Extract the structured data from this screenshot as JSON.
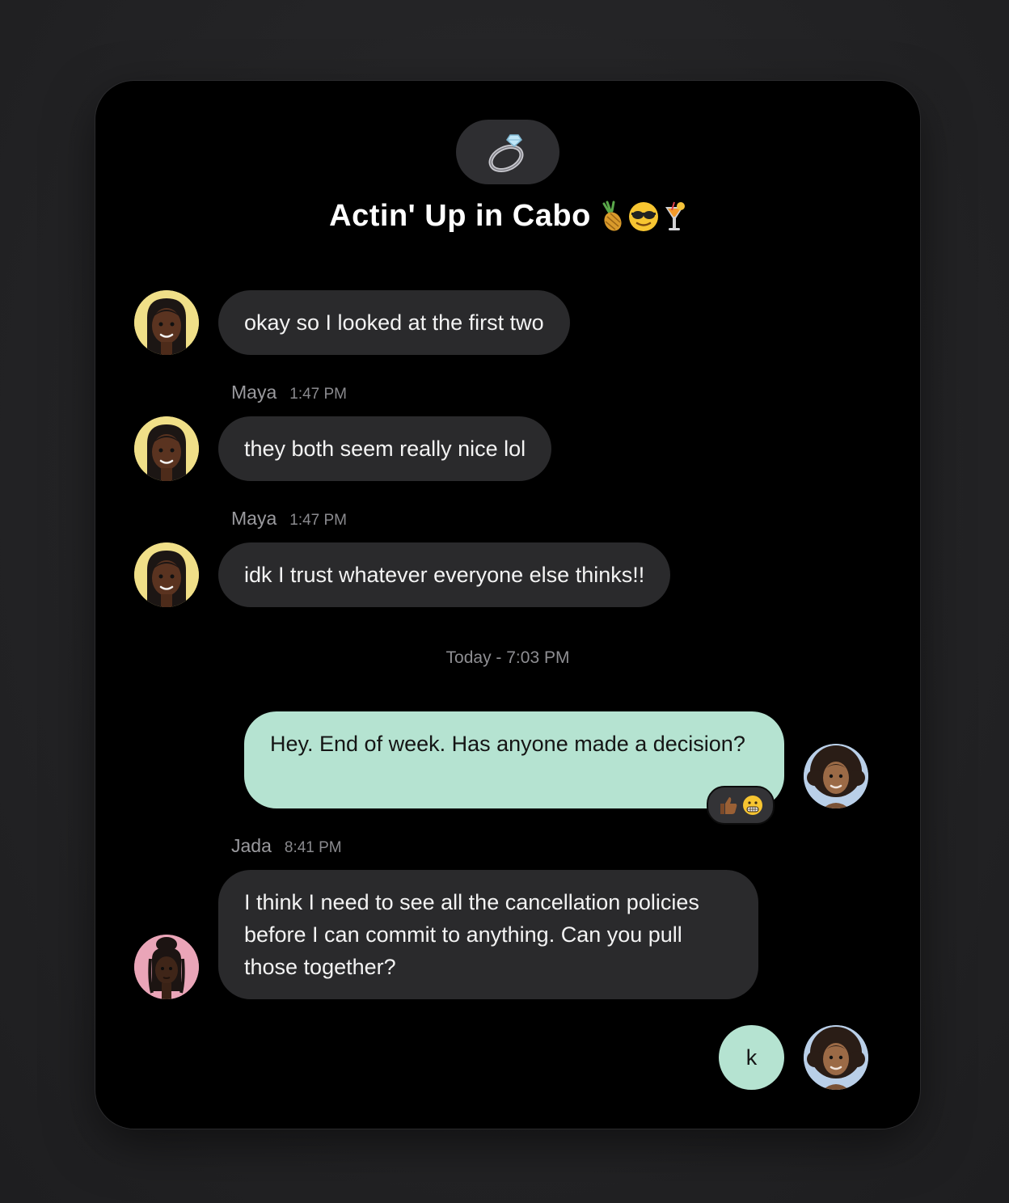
{
  "chat": {
    "group_icon": "ring-icon",
    "title": "Actin' Up in Cabo",
    "title_emojis": [
      "pineapple-icon",
      "sunglasses-face-icon",
      "tropical-drink-icon"
    ],
    "messages": [
      {
        "sender": "",
        "time": "",
        "text": "okay so I looked at the first two",
        "direction": "incoming"
      },
      {
        "sender": "Maya",
        "time": "1:47 PM",
        "text": "they both seem really nice lol",
        "direction": "incoming"
      },
      {
        "sender": "Maya",
        "time": "1:47 PM",
        "text": "idk I trust whatever everyone else thinks!!",
        "direction": "incoming"
      }
    ],
    "divider": "Today - 7:03 PM",
    "outgoing_1": {
      "text": "Hey. End of week. Has anyone made a decision?",
      "reactions": [
        "thumbs-up-icon",
        "grimacing-face-icon"
      ]
    },
    "jada_message": {
      "sender": "Jada",
      "time": "8:41 PM",
      "text": "I think I need to see all the cancellation policies before I can commit to anything. Can you pull those together?"
    },
    "outgoing_2": {
      "text": "k"
    },
    "colors": {
      "incoming_bubble": "#2a2a2c",
      "outgoing_bubble": "#b5e3d1",
      "maya_avatar_bg": "#f0df88",
      "jada_avatar_bg": "#eaa5b8",
      "self_avatar_bg": "#b9cfe8"
    }
  }
}
